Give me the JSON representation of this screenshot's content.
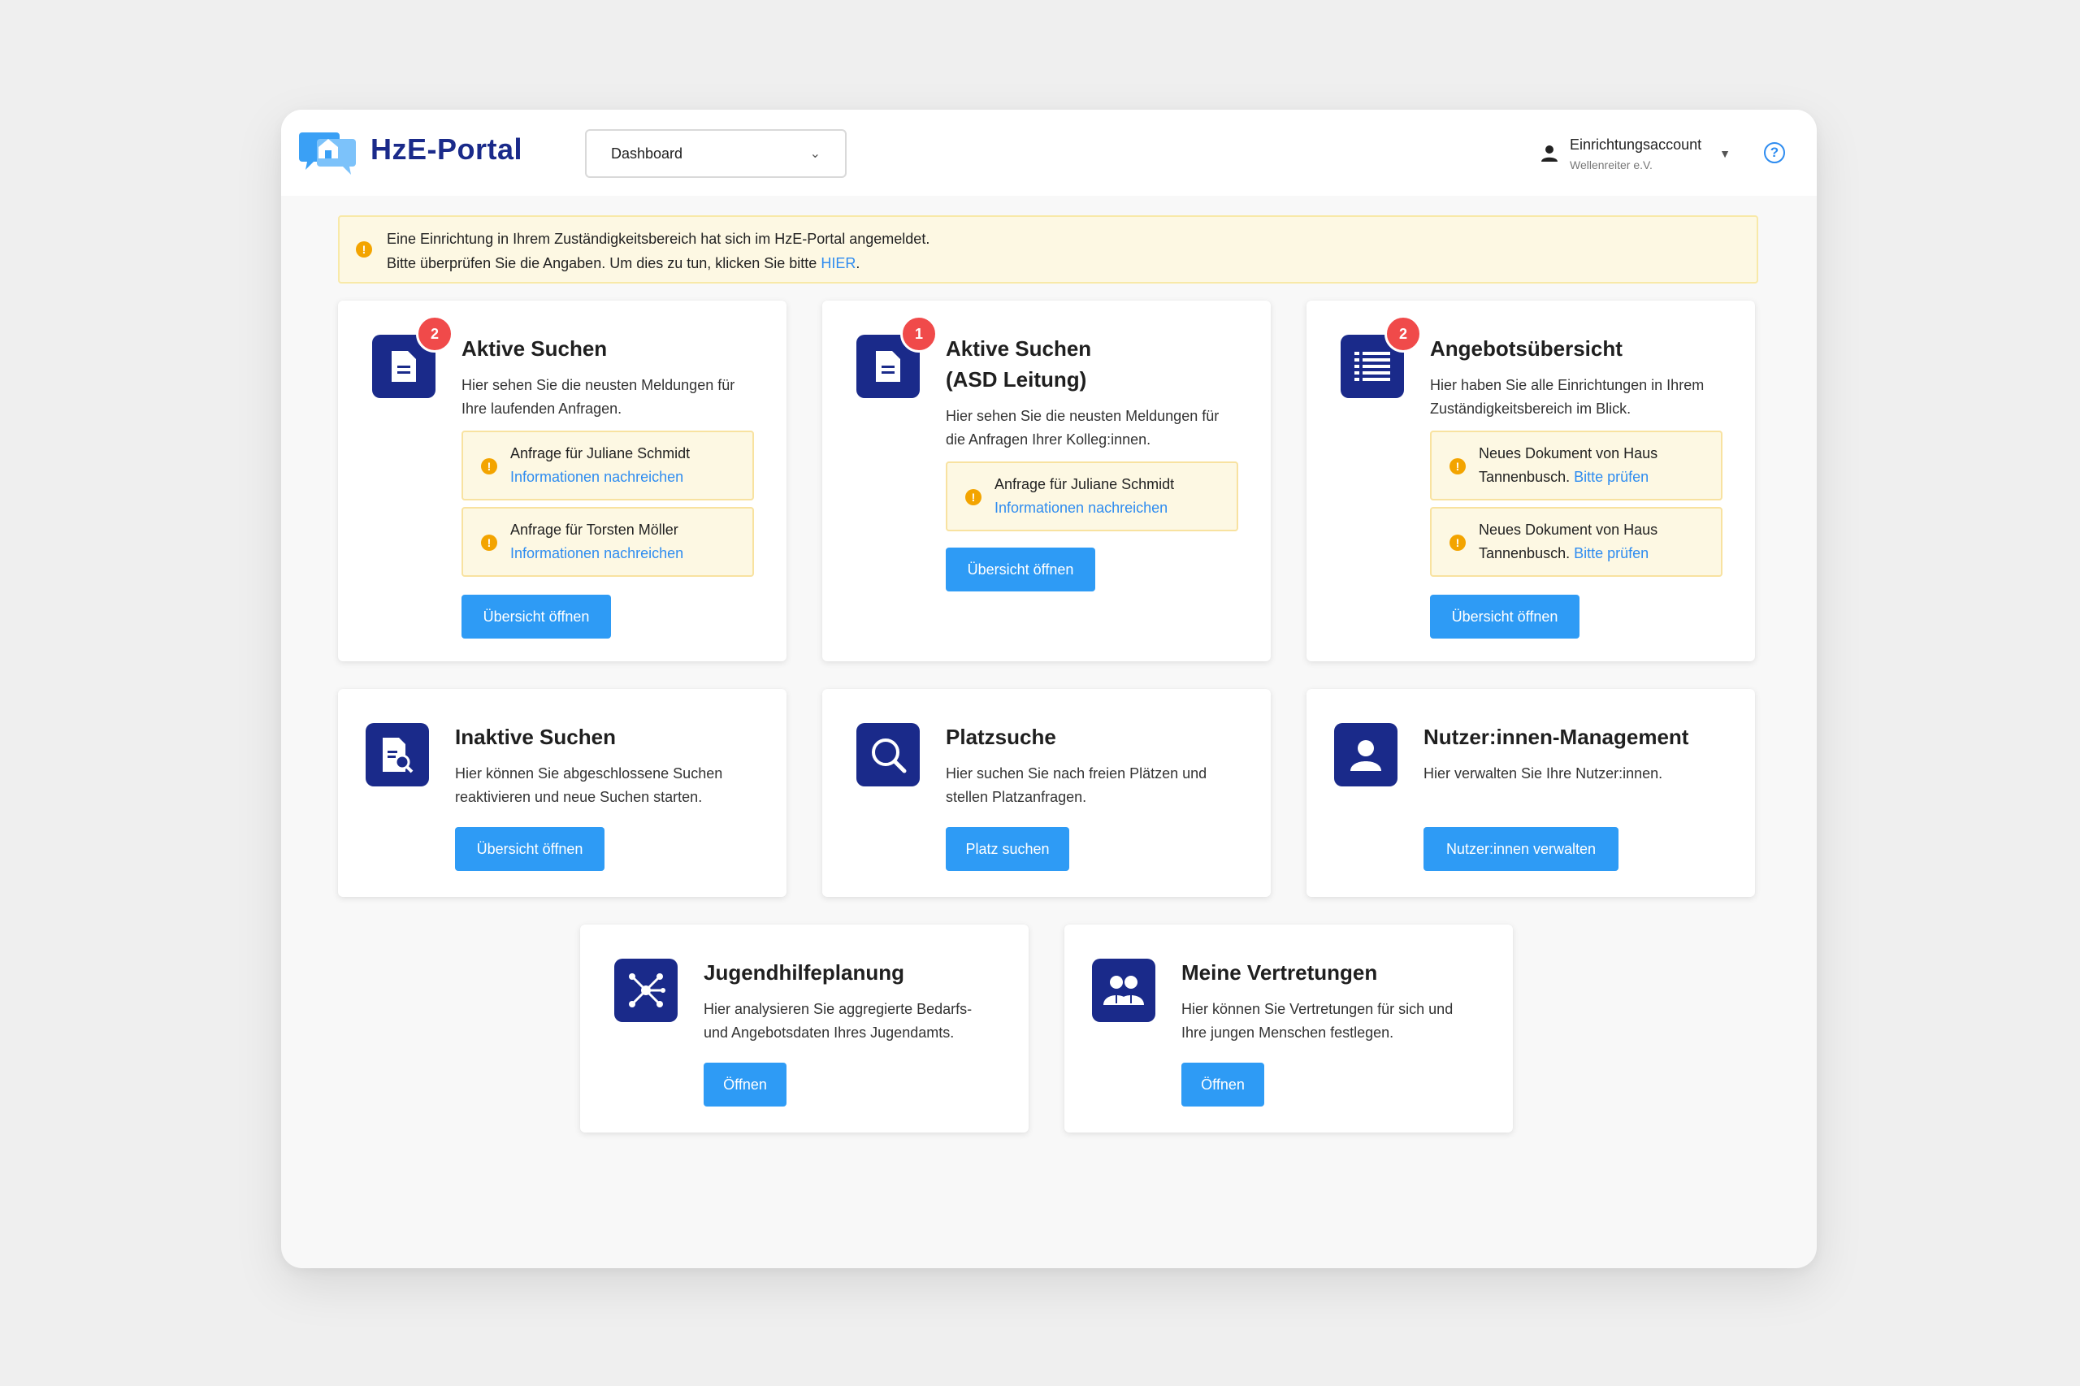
{
  "header": {
    "brand": "HzE-Portal",
    "view_select": "Dashboard",
    "account_name": "Einrichtungsaccount",
    "account_org": "Wellenreiter e.V.",
    "help": "?"
  },
  "notice": {
    "line1": "Eine Einrichtung in Ihrem Zuständigkeitsbereich hat sich im HzE-Portal angemeldet.",
    "line2": "Bitte überprüfen Sie die Angaben. Um dies zu tun, klicken Sie bitte",
    "link": "HIER",
    "end": "."
  },
  "cards": [
    {
      "title": "Aktive Suchen",
      "badge": "2",
      "desc1": "Hier sehen Sie die neusten Meldungen für",
      "desc2": "Ihre laufenden Anfragen.",
      "items": [
        {
          "text": "Anfrage für Juliane Schmidt",
          "link": "Informationen nachreichen"
        },
        {
          "text": "Anfrage für Torsten Möller",
          "link": "Informationen nachreichen"
        }
      ],
      "button": "Übersicht öffnen"
    },
    {
      "title1": "Aktive Suchen",
      "title2": "(ASD Leitung)",
      "badge": "1",
      "desc1": "Hier sehen Sie die neusten Meldungen für",
      "desc2": "die Anfragen Ihrer Kolleg:innen.",
      "items": [
        {
          "text": "Anfrage für Juliane Schmidt",
          "link": "Informationen nachreichen"
        }
      ],
      "button": "Übersicht öffnen"
    },
    {
      "title": "Angebotsübersicht",
      "badge": "2",
      "desc1": "Hier haben Sie alle Einrichtungen in Ihrem",
      "desc2": "Zuständigkeitsbereich im Blick.",
      "items": [
        {
          "text1": "Neues Dokument von Haus",
          "text2": "Tannenbusch.",
          "link": "Bitte prüfen"
        },
        {
          "text1": "Neues Dokument von Haus",
          "text2": "Tannenbusch.",
          "link": "Bitte prüfen"
        }
      ],
      "button": "Übersicht öffnen"
    },
    {
      "title": "Inaktive Suchen",
      "desc1": "Hier können Sie abgeschlossene Suchen",
      "desc2": "reaktivieren und neue Suchen starten.",
      "button": "Übersicht öffnen"
    },
    {
      "title": "Platzsuche",
      "desc1": "Hier suchen Sie nach freien Plätzen und",
      "desc2": "stellen Platzanfragen.",
      "button": "Platz suchen"
    },
    {
      "title": "Nutzer:innen-Management",
      "desc1": "Hier verwalten Sie Ihre Nutzer:innen.",
      "button": "Nutzer:innen verwalten"
    },
    {
      "title": "Jugendhilfeplanung",
      "desc1": "Hier analysieren Sie aggregierte Bedarfs-",
      "desc2": "und Angebotsdaten Ihres Jugendamts.",
      "button": "Öffnen"
    },
    {
      "title": "Meine Vertretungen",
      "desc1": "Hier können Sie Vertretungen für sich und",
      "desc2": "Ihre jungen Menschen festlegen.",
      "button": "Öffnen"
    }
  ],
  "colors": {
    "brand": "#1a2a8a",
    "accent": "#2e9bf5",
    "badge": "#f04a4a",
    "warning": "#f3a400",
    "notice_bg": "#fdf8e3"
  },
  "icons": {
    "info": "!"
  }
}
